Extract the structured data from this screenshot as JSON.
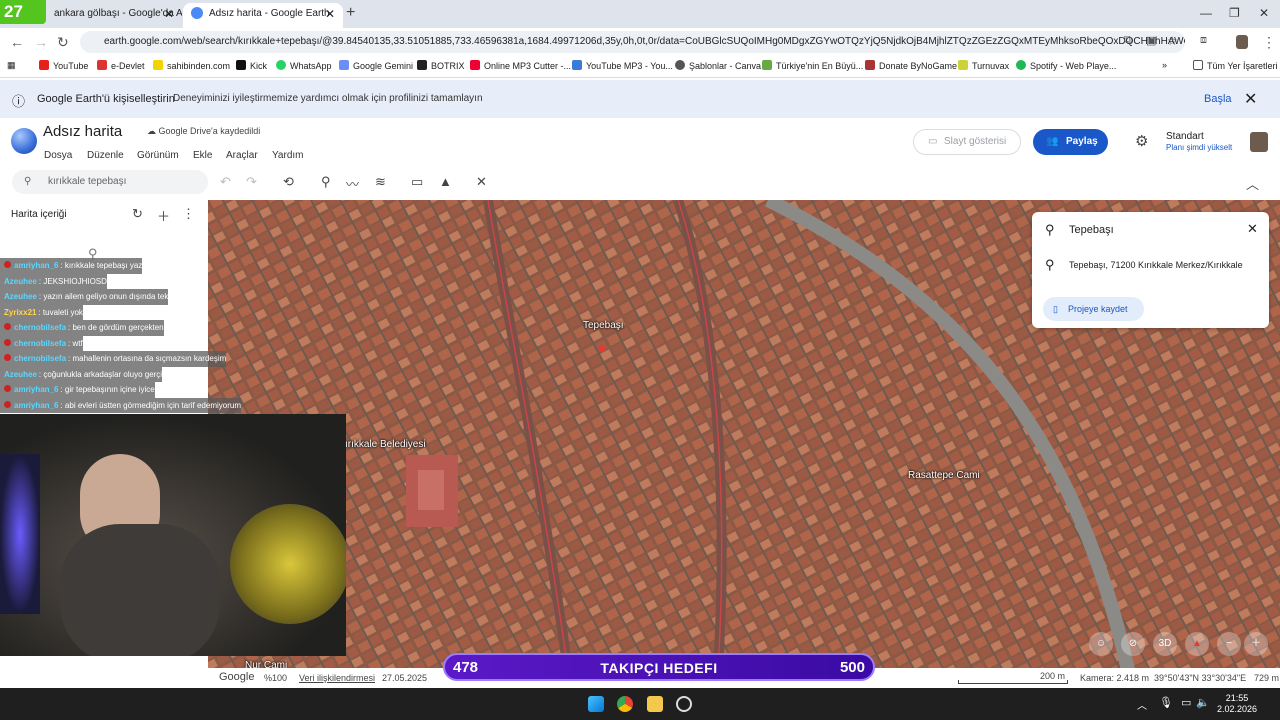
{
  "browser": {
    "tabs": [
      {
        "label": "ankara gölbaşı - Google'da Ara",
        "active": false
      },
      {
        "label": "Adsız harita - Google Earth",
        "active": true
      }
    ],
    "badge": "27",
    "url": "earth.google.com/web/search/kırıkkale+tepebaşı/@39.84540135,33.51051885,733.46596381a,1684.49971206d,35y,0h,0t,0r/data=CoUBGlcSUQoIMHg0MDgxZGYwOTQzYjQ5NjdkOjB4MjhlZTQzZGEzZGQxMTEyMhksoRbeQOxDQCHNhHAWQMFA..."
  },
  "bookmarks": [
    {
      "label": "YouTube",
      "color": "#e62117"
    },
    {
      "label": "e-Devlet",
      "color": "#d33"
    },
    {
      "label": "sahibinden.com",
      "color": "#f5d300"
    },
    {
      "label": "Kick",
      "color": "#111"
    },
    {
      "label": "WhatsApp",
      "color": "#25d366"
    },
    {
      "label": "Google Gemini",
      "color": "#6b8df5"
    },
    {
      "label": "BOTRIX",
      "color": "#222"
    },
    {
      "label": "Online MP3 Cutter -...",
      "color": "#e03"
    },
    {
      "label": "YouTube MP3 - You...",
      "color": "#3a7bd5"
    },
    {
      "label": "Şablonlar - Canva",
      "color": "#555"
    },
    {
      "label": "Türkiye'nin En Büyü...",
      "color": "#6a4"
    },
    {
      "label": "Donate ByNoGame",
      "color": "#a33"
    },
    {
      "label": "Turnuvax",
      "color": "#ccd23a"
    },
    {
      "label": "Spotify - Web Playe...",
      "color": "#1db954"
    },
    {
      "label": "Tüm Yer İşaretleri",
      "color": "#555"
    }
  ],
  "banner": {
    "title": "Google Earth'ü kişiselleştirin",
    "subtitle": "Deneyiminizi iyileştirmemize yardımcı olmak için profilinizi tamamlayın",
    "start": "Başla"
  },
  "earth": {
    "doc_title": "Adsız harita",
    "saved": "Google Drive'a kaydedildi",
    "menu": [
      "Dosya",
      "Düzenle",
      "Görünüm",
      "Ekle",
      "Araçlar",
      "Yardım"
    ],
    "slideshow": "Slayt gösterisi",
    "share": "Paylaş",
    "plan": "Standart",
    "upgrade": "Planı şimdi yükselt",
    "search_value": "kırıkkale tepebaşı"
  },
  "panel": {
    "title": "Harita içeriği"
  },
  "map": {
    "labels": {
      "pin": "Tepebaşı",
      "municipality": "ırıkkale Belediyesi",
      "mosque": "Rasattepe Cami",
      "bottom": "Nur Cami"
    }
  },
  "infocard": {
    "title": "Tepebaşı",
    "address": "Tepebaşı, 71200 Kırıkkale Merkez/Kırıkkale",
    "save": "Projeye kaydet"
  },
  "chat": [
    {
      "name": "amriyhan_6",
      "text": ": kırıkkale tepebaşı yaz"
    },
    {
      "name": "Azeuhee",
      "text": ": JEKSHIOJHIOSD"
    },
    {
      "name": "Azeuhee",
      "text": ": yazın ailem geliyo onun dışında tek"
    },
    {
      "name": "Zyrixx21",
      "text": ": tuvaleti yok"
    },
    {
      "name": "chernobilsefa",
      "text": ": ben de gördüm gerçekten"
    },
    {
      "name": "chernobilsefa",
      "text": ": wtf"
    },
    {
      "name": "chernobilsefa",
      "text": ": mahallenin ortasına da sıçmazsın kardeşim"
    },
    {
      "name": "Azeuhee",
      "text": ": çoğunlukla arkadaşlar oluyo gerçi"
    },
    {
      "name": "amriyhan_6",
      "text": ": gir tepebaşının içine iyice"
    },
    {
      "name": "amriyhan_6",
      "text": ": abi evleri üstten görmediğim için tarif edemiyorum"
    }
  ],
  "goal": {
    "current": "478",
    "label": "TAKIPÇI HEDEFI",
    "target": "500"
  },
  "status": {
    "brand": "Google",
    "zoom": "%100",
    "data": "Veri ilişkilendirmesi",
    "date": "27.05.2025",
    "scale": "200 m",
    "camera": "Kamera: 2.418 m",
    "coords": "39°50'43\"N 33°30'34\"E",
    "elev": "729 m"
  },
  "map_controls": {
    "threed": "3D"
  },
  "clock": {
    "time": "21:55",
    "date": "2.02.2026"
  }
}
